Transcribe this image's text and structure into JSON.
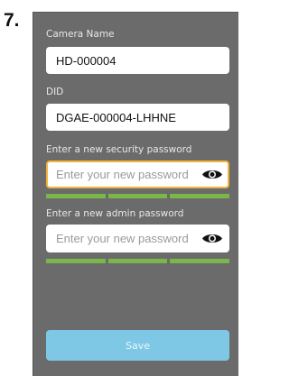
{
  "step": {
    "number": "7."
  },
  "form": {
    "camera_name": {
      "label": "Camera Name",
      "value": "HD-000004"
    },
    "did": {
      "label": "DID",
      "value": "DGAE-000004-LHHNE"
    },
    "security_password": {
      "label": "Enter a new security password",
      "placeholder": "Enter your new password",
      "value": "",
      "focused": true,
      "visibility_icon": "eye-icon",
      "strength_segments": 3
    },
    "admin_password": {
      "label": "Enter a new admin password",
      "placeholder": "Enter your new password",
      "value": "",
      "focused": false,
      "visibility_icon": "eye-icon",
      "strength_segments": 3
    },
    "save_label": "Save"
  },
  "colors": {
    "screen_background": "#6b6b6b",
    "focus_border": "#f0b43a",
    "strength_bar": "#7ab648",
    "save_button": "#7ec8e6"
  }
}
